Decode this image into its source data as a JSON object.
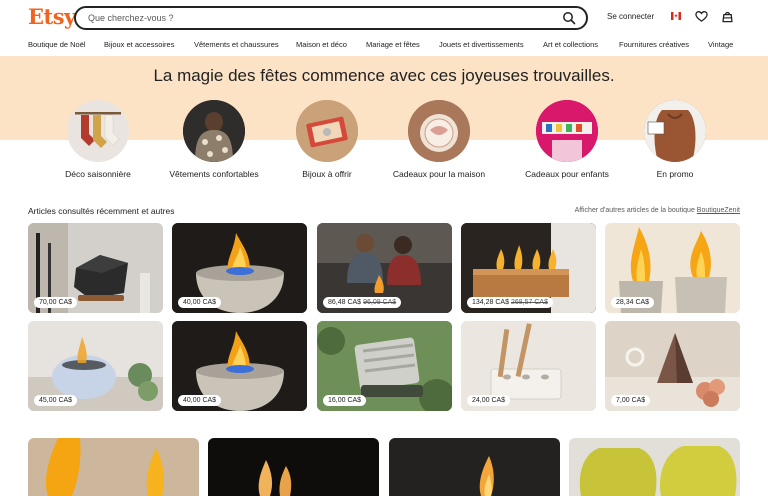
{
  "header": {
    "logo": "Etsy",
    "search_placeholder": "Que cherchez-vous ?",
    "signin_label": "Se connecter",
    "icons": [
      "search-icon",
      "canada-flag-icon",
      "heart-icon",
      "shopping-bag-icon"
    ]
  },
  "nav": [
    "Boutique de Noël",
    "Bijoux et accessoires",
    "Vêtements et chaussures",
    "Maison et déco",
    "Mariage et fêtes",
    "Jouets et divertissements",
    "Art et collections",
    "Fournitures créatives",
    "Vintage"
  ],
  "banner": {
    "title": "La magie des fêtes commence avec ces joyeuses trouvailles.",
    "categories": [
      "Déco saisonnière",
      "Vêtements confortables",
      "Bijoux à offrir",
      "Cadeaux pour la maison",
      "Cadeaux pour enfants",
      "En promo"
    ]
  },
  "recent": {
    "title": "Articles consultés récemment et autres",
    "link_prefix": "Afficher d'autres articles de la boutique",
    "link_shop": "BoutiqueZenit",
    "items": [
      {
        "price": "70,00 CA$",
        "old": ""
      },
      {
        "price": "40,00 CA$",
        "old": ""
      },
      {
        "price": "86,48 CA$",
        "old": "96,09 CA$"
      },
      {
        "price": "134,28 CA$",
        "old": "268,57 CA$"
      },
      {
        "price": "28,34 CA$",
        "old": ""
      },
      {
        "price": "45,00 CA$",
        "old": ""
      },
      {
        "price": "40,00 CA$",
        "old": ""
      },
      {
        "price": "16,00 CA$",
        "old": ""
      },
      {
        "price": "24,00 CA$",
        "old": ""
      },
      {
        "price": "7,00 CA$",
        "old": ""
      }
    ]
  },
  "colors": {
    "brand": "#f1641e",
    "banner_bg": "#fde3c6",
    "text": "#222222"
  }
}
